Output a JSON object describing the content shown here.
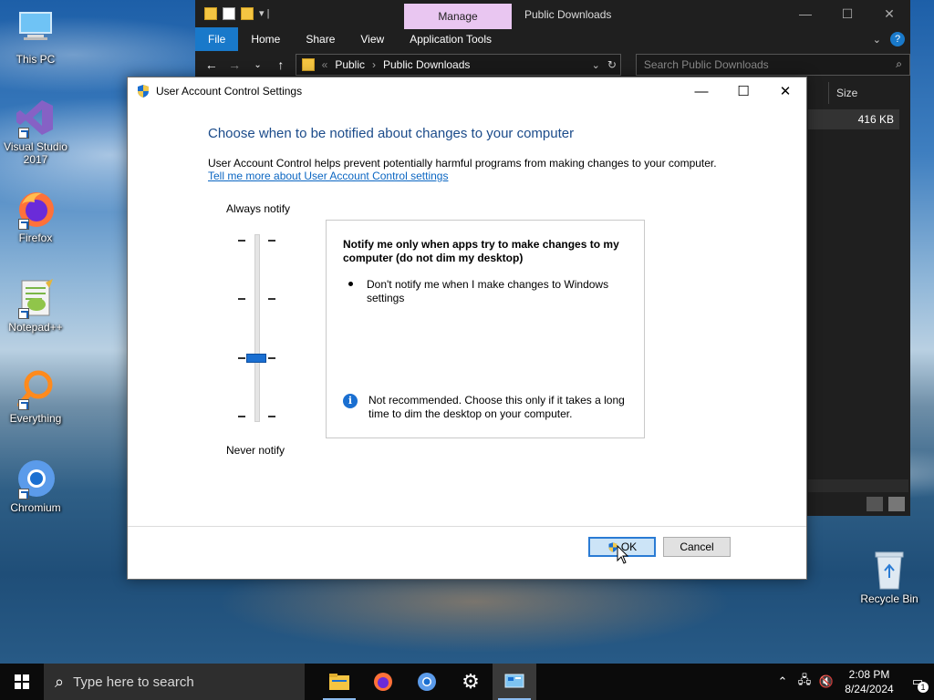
{
  "desktop": {
    "icons": [
      {
        "label": "This PC"
      },
      {
        "label": "Visual Studio 2017"
      },
      {
        "label": "Firefox"
      },
      {
        "label": "Notepad++"
      },
      {
        "label": "Everything"
      },
      {
        "label": "Chromium"
      },
      {
        "label": "Recycle Bin"
      }
    ]
  },
  "explorer": {
    "context_tab": "Manage",
    "title": "Public Downloads",
    "ribbon_tabs": [
      "File",
      "Home",
      "Share",
      "View",
      "Application Tools"
    ],
    "breadcrumb": [
      "Public",
      "Public Downloads"
    ],
    "breadcrumb_prefix": "«",
    "search_placeholder": "Search Public Downloads",
    "column_size": "Size",
    "row_size": "416 KB"
  },
  "uac": {
    "title": "User Account Control Settings",
    "heading": "Choose when to be notified about changes to your computer",
    "description": "User Account Control helps prevent potentially harmful programs from making changes to your computer.",
    "link": "Tell me more about User Account Control settings",
    "slider": {
      "top_label": "Always notify",
      "bottom_label": "Never notify",
      "level": 3,
      "levels": 4
    },
    "info_title": "Notify me only when apps try to make changes to my computer (do not dim my desktop)",
    "bullet": "Don't notify me when I make changes to Windows settings",
    "note": "Not recommended. Choose this only if it takes a long time to dim the desktop on your computer.",
    "ok_label": "OK",
    "cancel_label": "Cancel"
  },
  "taskbar": {
    "search_placeholder": "Type here to search",
    "apps": [
      "file-explorer",
      "firefox",
      "chromium",
      "settings",
      "uac-settings"
    ],
    "time": "2:08 PM",
    "date": "8/24/2024",
    "notification_count": "1"
  },
  "colors": {
    "accent": "#1979ca",
    "heading": "#1b4b8a",
    "link": "#0b66c2",
    "manage_tab": "#e9c6f1"
  }
}
